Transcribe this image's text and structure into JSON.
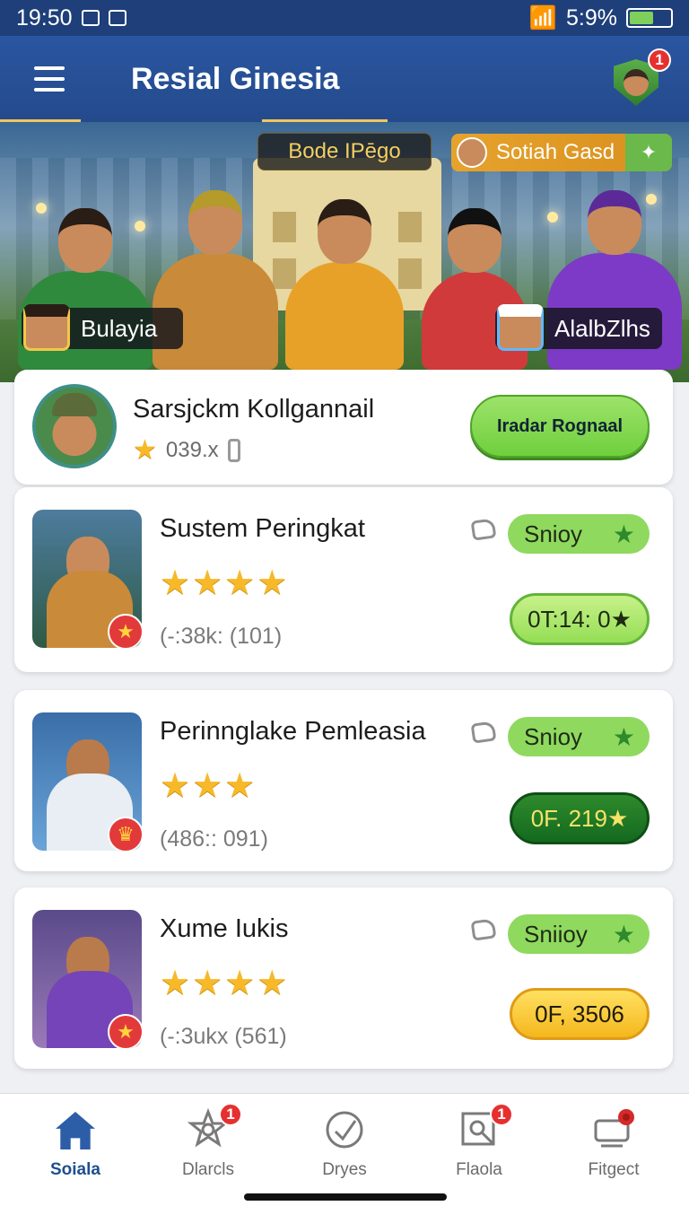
{
  "status_bar": {
    "time": "19:50",
    "battery": "5:9%"
  },
  "header": {
    "title": "Resial Ginesia",
    "notification_count": "1"
  },
  "banner": {
    "center_tag": "Bode IPēgo",
    "right_tag": "Sotiah Gasd",
    "left_player": "Bulayia",
    "right_player": "AlalbZlhs"
  },
  "featured": {
    "name": "Sarsjckm Kollgannail",
    "stat": "039.x",
    "cta_label": "Iradar Rognaal"
  },
  "items": [
    {
      "title": "Sustem Peringkat",
      "stars": "★★★★",
      "rating": 4,
      "meta": "(-:38k: (101)",
      "pill": "Snioy",
      "price": "0T:14: 0★"
    },
    {
      "title": "Perinnglake Pemleasia",
      "stars": "★★★",
      "rating": 3,
      "meta": "(486:: 091)",
      "pill": "Snioy",
      "price": "0F. 219★"
    },
    {
      "title": "Xume Iukis",
      "stars": "★★★★",
      "rating": 4,
      "meta": "(-:3ukx (561)",
      "pill": "Sniioy",
      "price": "0F, 3506"
    }
  ],
  "nav": [
    {
      "label": "Soiala",
      "icon": "home-icon",
      "badge": ""
    },
    {
      "label": "Dlarcls",
      "icon": "badge-star-icon",
      "badge": "1"
    },
    {
      "label": "Dryes",
      "icon": "check-circle-icon",
      "badge": ""
    },
    {
      "label": "Flaola",
      "icon": "frame-search-icon",
      "badge": "1"
    },
    {
      "label": "Fitgect",
      "icon": "chat-rose-icon",
      "badge": ""
    }
  ],
  "colors": {
    "primary": "#244a8c",
    "accent_green": "#8fd95f",
    "gold": "#f4b71d",
    "alert": "#e63030"
  }
}
